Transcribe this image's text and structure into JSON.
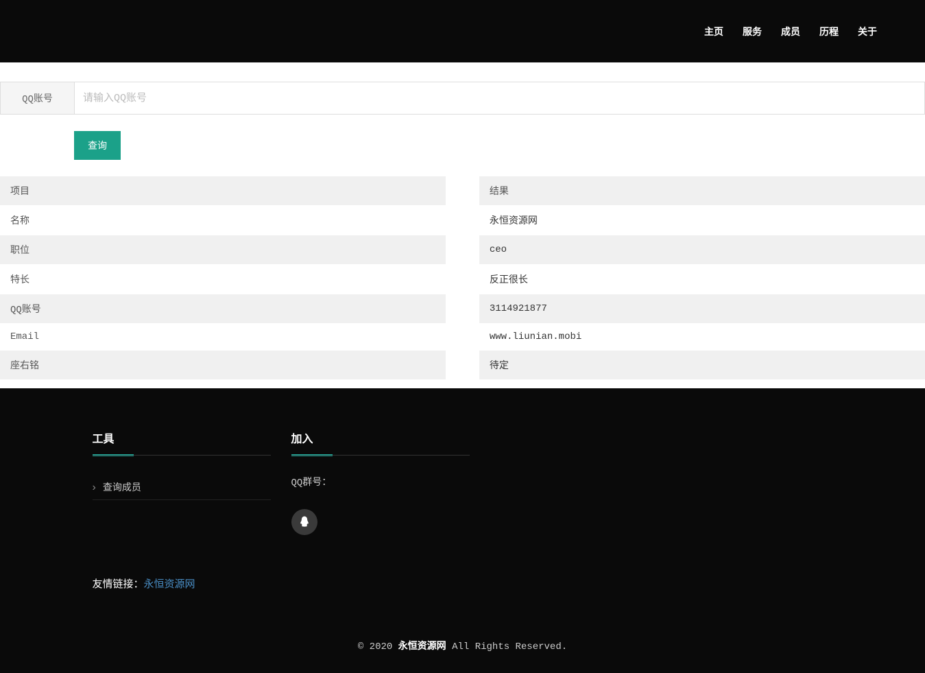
{
  "nav": [
    "主页",
    "服务",
    "成员",
    "历程",
    "关于"
  ],
  "search": {
    "label": "QQ账号",
    "placeholder": "请输入QQ账号",
    "button": "查询"
  },
  "table": {
    "headers": [
      "项目",
      "结果"
    ],
    "rows": [
      {
        "k": "名称",
        "v": "永恒资源网"
      },
      {
        "k": "职位",
        "v": "ceo"
      },
      {
        "k": "特长",
        "v": "反正很长"
      },
      {
        "k": "QQ账号",
        "v": "3114921877"
      },
      {
        "k": "Email",
        "v": "www.liunian.mobi"
      },
      {
        "k": "座右铭",
        "v": "待定"
      }
    ]
  },
  "footer": {
    "tools_title": "工具",
    "tools_item": "查询成员",
    "join_title": "加入",
    "join_text": "QQ群号：",
    "friend_label": "友情链接：",
    "friend_link": "永恒资源网",
    "copy_pre": "© 2020 ",
    "copy_name": "永恒资源网",
    "copy_post": " All Rights Reserved."
  }
}
